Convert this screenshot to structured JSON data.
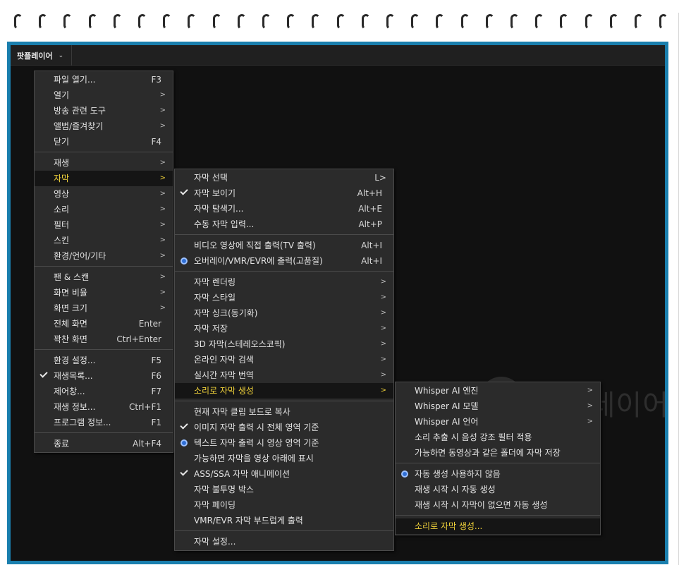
{
  "app": {
    "menu_title": "팟플레이어",
    "menu_chevron": "⌄",
    "watermark": "팟플레이어"
  },
  "main_menu": [
    {
      "label": "파일 열기...",
      "shortcut": "F3"
    },
    {
      "label": "열기",
      "arrow": ">"
    },
    {
      "label": "방송 관련 도구",
      "arrow": ">"
    },
    {
      "label": "앨범/즐겨찾기",
      "arrow": ">"
    },
    {
      "label": "닫기",
      "shortcut": "F4"
    },
    {
      "label": "재생",
      "arrow": ">"
    },
    {
      "label": "자막",
      "arrow": ">"
    },
    {
      "label": "영상",
      "arrow": ">"
    },
    {
      "label": "소리",
      "arrow": ">"
    },
    {
      "label": "필터",
      "arrow": ">"
    },
    {
      "label": "스킨",
      "arrow": ">"
    },
    {
      "label": "환경/언어/기타",
      "arrow": ">"
    },
    {
      "label": "팬 & 스캔",
      "arrow": ">"
    },
    {
      "label": "화면 비율",
      "arrow": ">"
    },
    {
      "label": "화면 크기",
      "arrow": ">"
    },
    {
      "label": "전체 화면",
      "shortcut": "Enter"
    },
    {
      "label": "꽉찬 화면",
      "shortcut": "Ctrl+Enter"
    },
    {
      "label": "환경 설정...",
      "shortcut": "F5"
    },
    {
      "label": "재생목록...",
      "shortcut": "F6"
    },
    {
      "label": "제어창...",
      "shortcut": "F7"
    },
    {
      "label": "재생 정보...",
      "shortcut": "Ctrl+F1"
    },
    {
      "label": "프로그램 정보...",
      "shortcut": "F1"
    },
    {
      "label": "종료",
      "shortcut": "Alt+F4"
    }
  ],
  "subtitle_menu": [
    {
      "label": "자막 선택",
      "shortcut": "L>"
    },
    {
      "label": "자막 보이기",
      "shortcut": "Alt+H"
    },
    {
      "label": "자막 탐색기...",
      "shortcut": "Alt+E"
    },
    {
      "label": "수동 자막 입력...",
      "shortcut": "Alt+P"
    },
    {
      "label": "비디오 영상에 직접 출력(TV 출력)",
      "shortcut": "Alt+I"
    },
    {
      "label": "오버레이/VMR/EVR에 출력(고품질)",
      "shortcut": "Alt+I"
    },
    {
      "label": "자막 렌더링",
      "arrow": ">"
    },
    {
      "label": "자막 스타일",
      "arrow": ">"
    },
    {
      "label": "자막 싱크(동기화)",
      "arrow": ">"
    },
    {
      "label": "자막 저장",
      "arrow": ">"
    },
    {
      "label": "3D 자막(스테레오스코픽)",
      "arrow": ">"
    },
    {
      "label": "온라인 자막 검색",
      "arrow": ">"
    },
    {
      "label": "실시간 자막 번역",
      "arrow": ">"
    },
    {
      "label": "소리로 자막 생성",
      "arrow": ">"
    },
    {
      "label": "현재 자막 클립 보드로 복사"
    },
    {
      "label": "이미지 자막 출력 시 전체 영역 기준"
    },
    {
      "label": "텍스트 자막 출력 시 영상 영역 기준"
    },
    {
      "label": "가능하면 자막을 영상 아래에 표시"
    },
    {
      "label": "ASS/SSA 자막 애니메이션"
    },
    {
      "label": "자막 불투명 박스"
    },
    {
      "label": "자막 페이딩"
    },
    {
      "label": "VMR/EVR 자막 부드럽게 출력"
    },
    {
      "label": "자막 설정..."
    }
  ],
  "audio_sub_menu": [
    {
      "label": "Whisper AI 엔진",
      "arrow": ">"
    },
    {
      "label": "Whisper AI 모델",
      "arrow": ">"
    },
    {
      "label": "Whisper AI 언어",
      "arrow": ">"
    },
    {
      "label": "소리 추출 시 음성 강조 필터 적용"
    },
    {
      "label": "가능하면 동영상과 같은 폴더에 자막 저장"
    },
    {
      "label": "자동 생성 사용하지 않음"
    },
    {
      "label": "재생 시작 시 자동 생성"
    },
    {
      "label": "재생 시작 시 자막이 없으면 자동 생성"
    },
    {
      "label": "소리로 자막 생성..."
    }
  ]
}
